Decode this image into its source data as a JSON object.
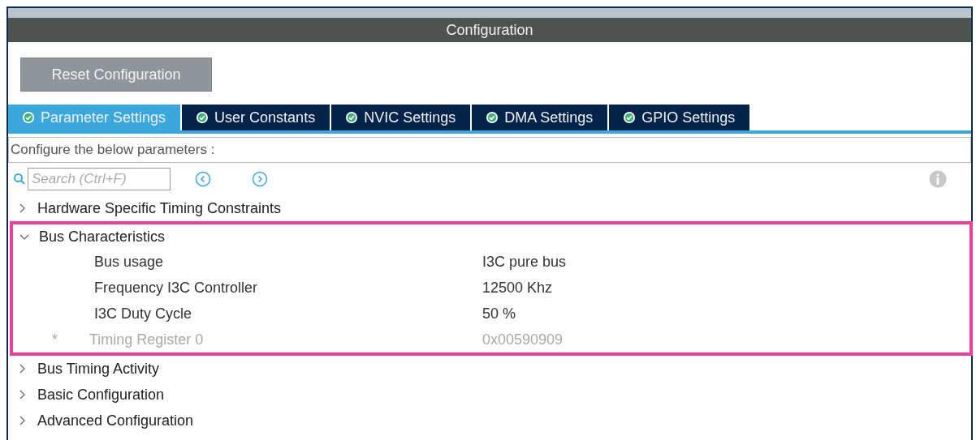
{
  "panel": {
    "title": "Configuration"
  },
  "reset_button": "Reset Configuration",
  "tabs": [
    {
      "label": "Parameter Settings",
      "selected": true
    },
    {
      "label": "User Constants",
      "selected": false
    },
    {
      "label": "NVIC Settings",
      "selected": false
    },
    {
      "label": "DMA Settings",
      "selected": false
    },
    {
      "label": "GPIO Settings",
      "selected": false
    }
  ],
  "description": "Configure the below parameters :",
  "search": {
    "placeholder": "Search (Ctrl+F)"
  },
  "groups": [
    {
      "label": "Hardware Specific Timing Constraints",
      "expanded": false,
      "highlighted": false
    },
    {
      "label": "Bus Characteristics",
      "expanded": true,
      "highlighted": true,
      "children": [
        {
          "name": "Bus usage",
          "value": "I3C pure bus",
          "disabled": false
        },
        {
          "name": "Frequency I3C Controller",
          "value": "12500 Khz",
          "disabled": false
        },
        {
          "name": "I3C Duty Cycle",
          "value": "50 %",
          "disabled": false
        },
        {
          "name": "Timing Register 0",
          "value": "0x00590909",
          "disabled": true,
          "marker": "*"
        }
      ]
    },
    {
      "label": "Bus Timing Activity",
      "expanded": false,
      "highlighted": false
    },
    {
      "label": "Basic Configuration",
      "expanded": false,
      "highlighted": false
    },
    {
      "label": "Advanced Configuration",
      "expanded": false,
      "highlighted": false
    }
  ]
}
